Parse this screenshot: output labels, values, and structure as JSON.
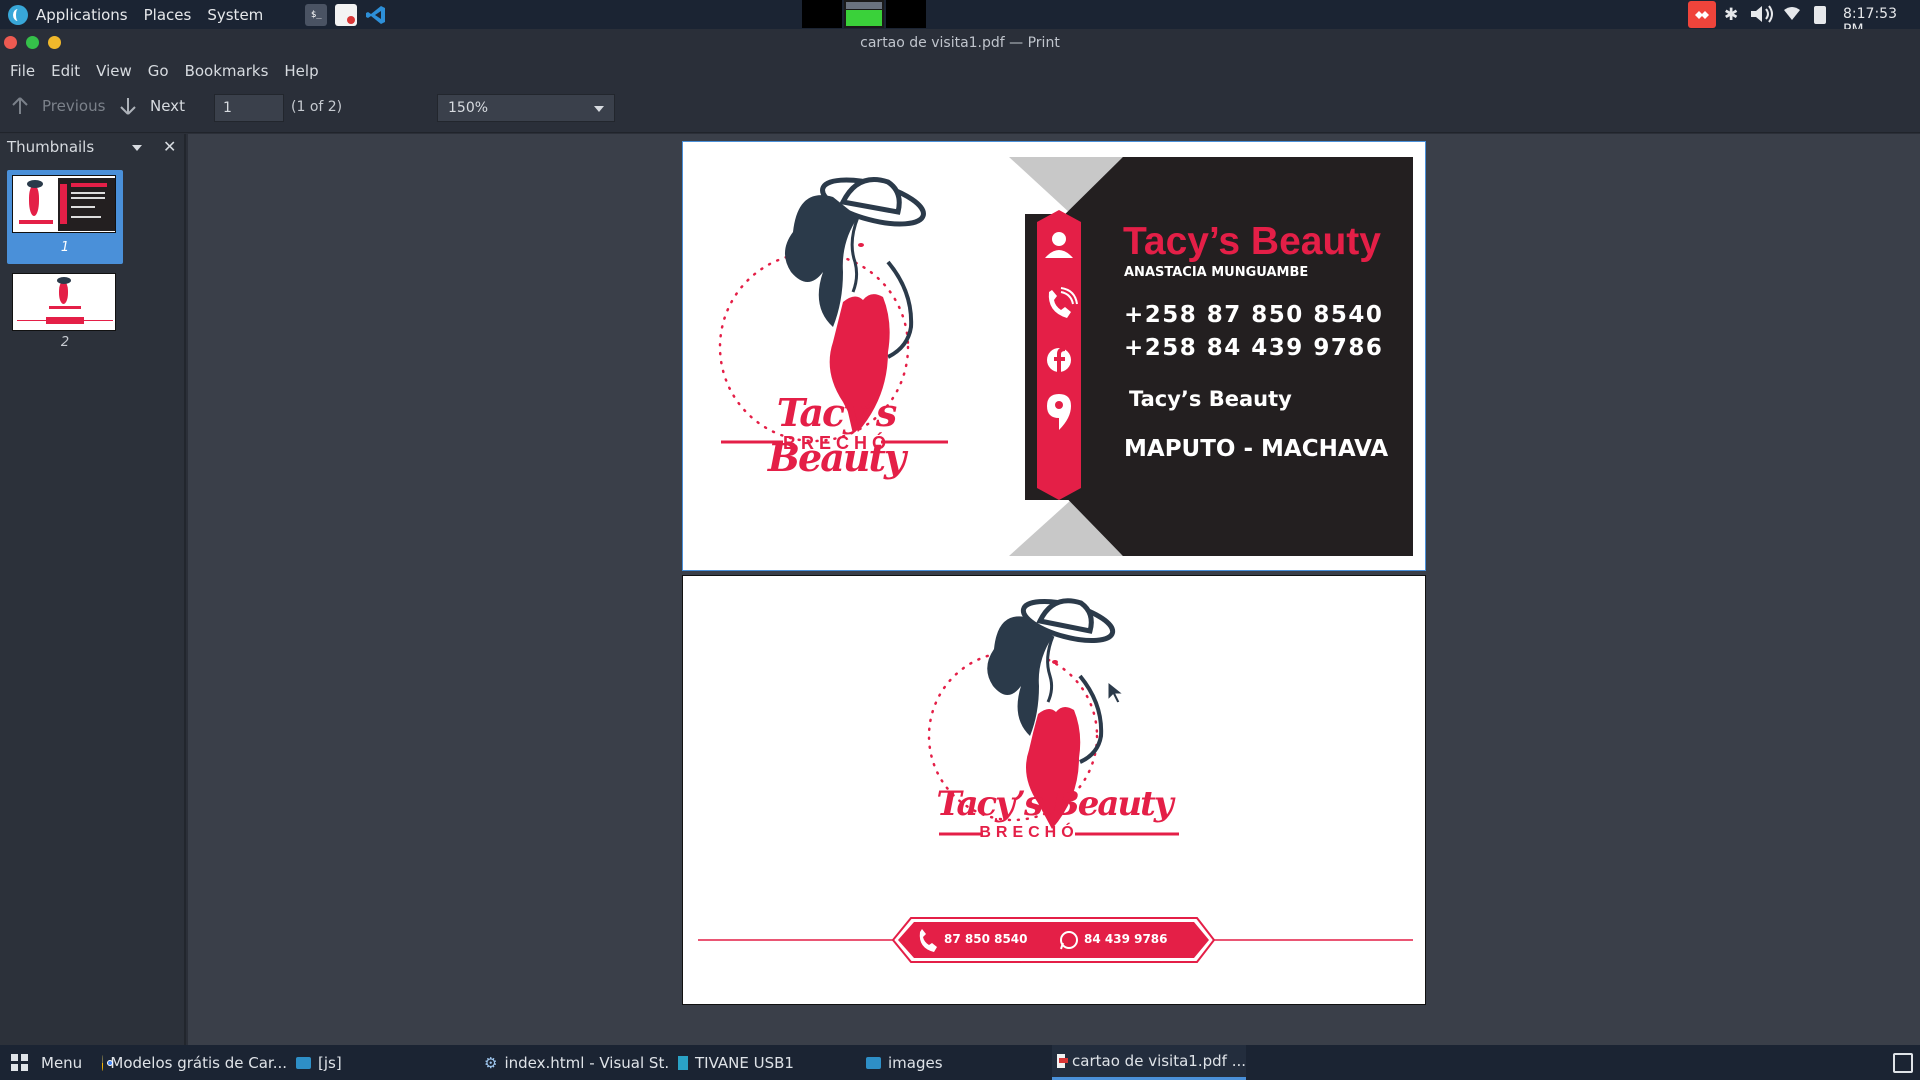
{
  "top_panel": {
    "menus": [
      "Applications",
      "Places",
      "System"
    ],
    "clock": "8:17:53 PM"
  },
  "window": {
    "title": "cartao de visita1.pdf — Print"
  },
  "menubar": [
    "File",
    "Edit",
    "View",
    "Go",
    "Bookmarks",
    "Help"
  ],
  "toolbar": {
    "previous_label": "Previous",
    "next_label": "Next",
    "page_input_value": "1",
    "page_count_label": "(1 of 2)",
    "zoom_value": "150%"
  },
  "sidebar": {
    "title": "Thumbnails",
    "thumbnails": [
      {
        "label": "1",
        "selected": true
      },
      {
        "label": "2",
        "selected": false
      }
    ]
  },
  "card_front": {
    "brand_name": "Tacy’s Beauty",
    "owner": "ANASTACIA MUNGUAMBE",
    "phone1": "+258 87 850 8540",
    "phone2": "+258 84 439 9786",
    "facebook": "Tacy’s Beauty",
    "location": "MAPUTO - MACHAVA",
    "logo_script": "Tacy’s Beauty",
    "logo_sub": "BRECHÓ"
  },
  "card_back": {
    "logo_script": "Tacy’s Beauty",
    "logo_sub": "BRECHÓ",
    "phone_call": "87 850 8540",
    "phone_whatsapp": "84 439 9786"
  },
  "taskbar": {
    "menu_label": "Menu",
    "tasks": [
      {
        "label": "Modelos grátis de Car..."
      },
      {
        "label": "[js]"
      },
      {
        "label": "index.html - Visual St..."
      },
      {
        "label": "TIVANE USB1"
      },
      {
        "label": "images"
      },
      {
        "label": "cartao de visita1.pdf ..."
      }
    ]
  },
  "colors": {
    "accent_pink": "#e41f47",
    "card_dark": "#231f20",
    "selection_blue": "#4a90d9"
  }
}
